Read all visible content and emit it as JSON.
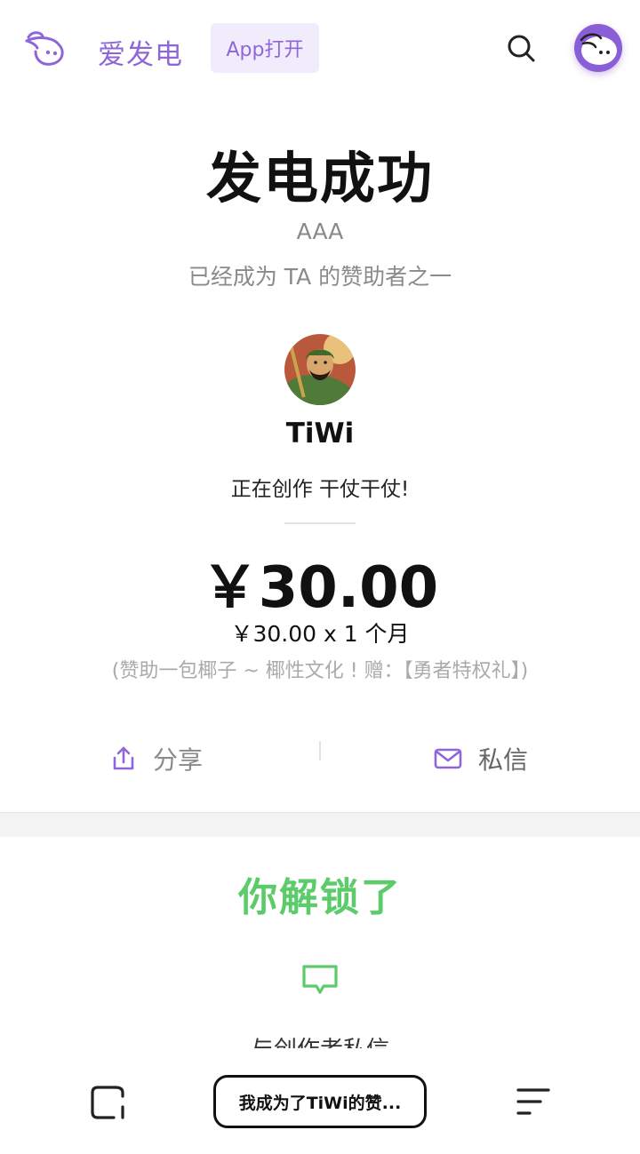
{
  "header": {
    "brand": "爱发电",
    "app_open_label": "App打开"
  },
  "result": {
    "title": "发电成功",
    "sponsor_name": "AAA",
    "sponsor_desc": "已经成为 TA 的赞助者之一"
  },
  "creator": {
    "name": "TiWi",
    "status": "正在创作 干仗干仗!"
  },
  "payment": {
    "amount": "￥30.00",
    "detail": "￥30.00 x 1 个月",
    "gift_note": "(赞助一包椰子 ~ 椰性文化 ! 赠：【勇者特权礼】)"
  },
  "actions": {
    "share_label": "分享",
    "message_label": "私信"
  },
  "unlock": {
    "title": "你解锁了",
    "item_label": "与创作者私信"
  },
  "browser": {
    "url_text": "我成为了TiWi的赞..."
  },
  "colors": {
    "accent": "#8f66d9",
    "unlock_green": "#5ccc6b"
  }
}
